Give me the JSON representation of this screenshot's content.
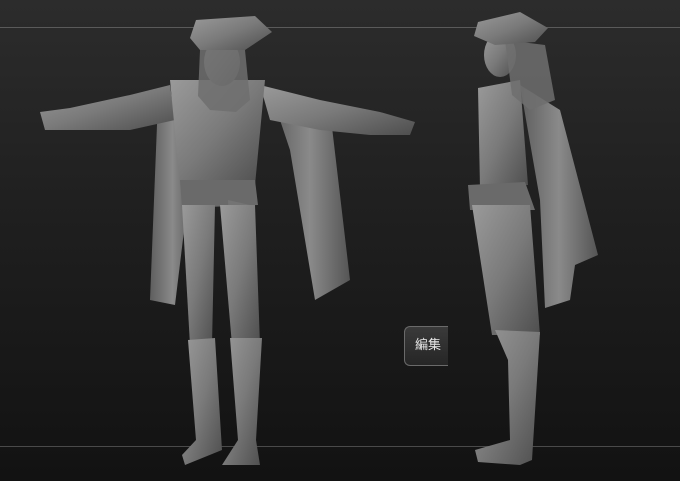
{
  "window": {
    "title": ""
  },
  "viewport": {
    "background_top": "#2c2c2c",
    "background_bottom": "#121212",
    "model_color": "#7c7c7c",
    "model_shadow": "#3a3a3a",
    "views": [
      "front-view",
      "side-view"
    ]
  },
  "side_tab": {
    "label": "編集"
  }
}
